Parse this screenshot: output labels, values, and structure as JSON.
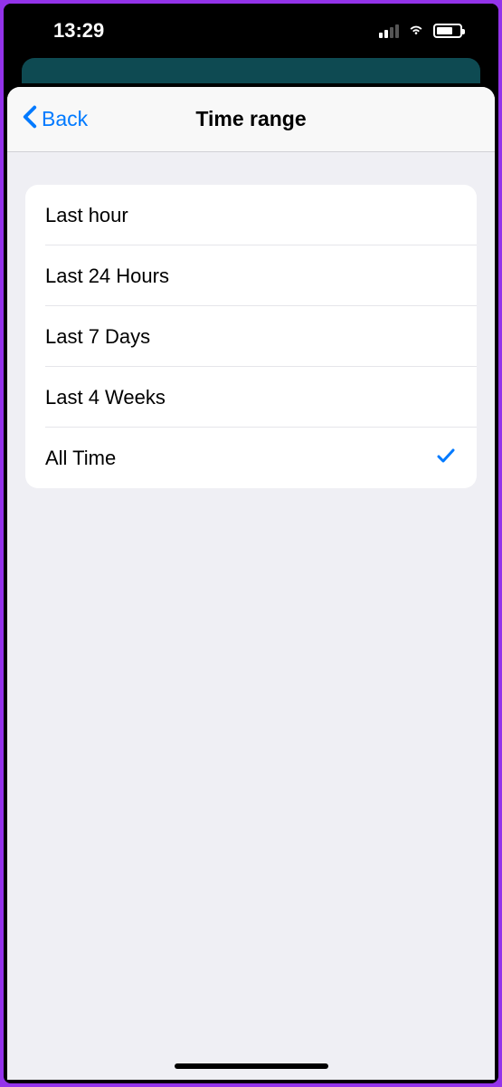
{
  "statusBar": {
    "time": "13:29"
  },
  "nav": {
    "backLabel": "Back",
    "title": "Time range"
  },
  "options": [
    {
      "label": "Last hour",
      "selected": false
    },
    {
      "label": "Last 24 Hours",
      "selected": false
    },
    {
      "label": "Last 7 Days",
      "selected": false
    },
    {
      "label": "Last 4 Weeks",
      "selected": false
    },
    {
      "label": "All Time",
      "selected": true
    }
  ],
  "colors": {
    "accent": "#007aff",
    "sheetBg": "#efeff4"
  }
}
